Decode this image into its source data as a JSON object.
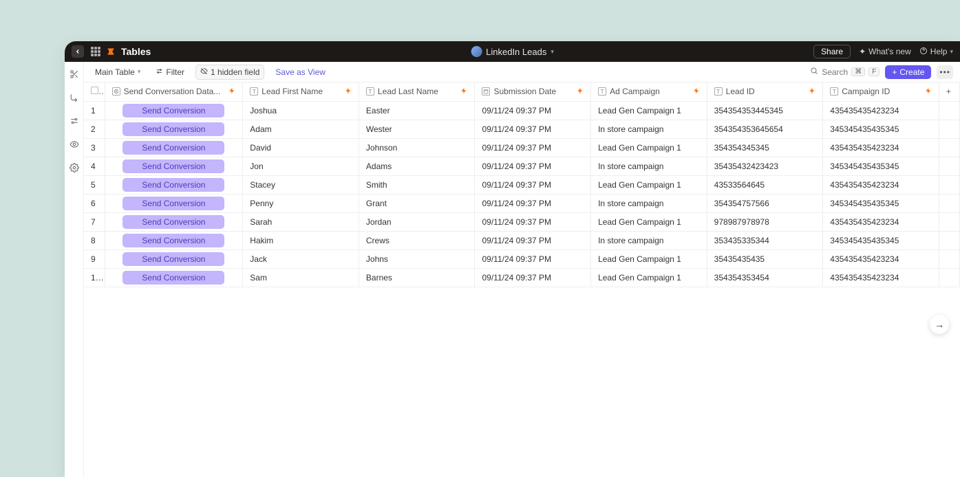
{
  "header": {
    "app_title": "Tables",
    "workspace_title": "LinkedIn Leads",
    "share": "Share",
    "whats_new": "What's new",
    "help": "Help"
  },
  "toolbar": {
    "view_name": "Main Table",
    "filter": "Filter",
    "hidden_label": "1 hidden field",
    "save_view": "Save as View",
    "search": "Search",
    "kbd1": "⌘",
    "kbd2": "F",
    "create": "Create"
  },
  "columns": [
    {
      "label": "Send Conversation Data...",
      "type": "action",
      "bolt": true
    },
    {
      "label": "Lead First Name",
      "type": "text",
      "bolt": true
    },
    {
      "label": "Lead Last Name",
      "type": "text",
      "bolt": true
    },
    {
      "label": "Submission Date",
      "type": "date",
      "bolt": true
    },
    {
      "label": "Ad Campaign",
      "type": "text",
      "bolt": true
    },
    {
      "label": "Lead ID",
      "type": "text",
      "bolt": true
    },
    {
      "label": "Campaign ID",
      "type": "text",
      "bolt": true
    }
  ],
  "action_pill_label": "Send Conversion",
  "rows": [
    {
      "first": "Joshua",
      "last": "Easter",
      "date": "09/11/24 09:37 PM",
      "campaign": "Lead Gen Campaign 1",
      "leadid": "354354353445345",
      "cid": "435435435423234"
    },
    {
      "first": "Adam",
      "last": "Wester",
      "date": "09/11/24 09:37 PM",
      "campaign": "In store campaign",
      "leadid": "354354353645654",
      "cid": "345345435435345"
    },
    {
      "first": "David",
      "last": "Johnson",
      "date": "09/11/24 09:37 PM",
      "campaign": "Lead Gen Campaign 1",
      "leadid": "354354345345",
      "cid": "435435435423234"
    },
    {
      "first": "Jon",
      "last": "Adams",
      "date": "09/11/24 09:37 PM",
      "campaign": "In store campaign",
      "leadid": "35435432423423",
      "cid": "345345435435345"
    },
    {
      "first": "Stacey",
      "last": "Smith",
      "date": "09/11/24 09:37 PM",
      "campaign": "Lead Gen Campaign 1",
      "leadid": "43533564645",
      "cid": "435435435423234"
    },
    {
      "first": "Penny",
      "last": "Grant",
      "date": "09/11/24 09:37 PM",
      "campaign": "In store campaign",
      "leadid": "354354757566",
      "cid": "345345435435345"
    },
    {
      "first": "Sarah",
      "last": "Jordan",
      "date": "09/11/24 09:37 PM",
      "campaign": "Lead Gen Campaign 1",
      "leadid": "978987978978",
      "cid": "435435435423234"
    },
    {
      "first": "Hakim",
      "last": "Crews",
      "date": "09/11/24 09:37 PM",
      "campaign": "In store campaign",
      "leadid": "353435335344",
      "cid": "345345435435345"
    },
    {
      "first": "Jack",
      "last": "Johns",
      "date": "09/11/24 09:37 PM",
      "campaign": "Lead Gen Campaign 1",
      "leadid": "35435435435",
      "cid": "435435435423234"
    },
    {
      "first": "Sam",
      "last": "Barnes",
      "date": "09/11/24 09:37 PM",
      "campaign": "Lead Gen Campaign 1",
      "leadid": "354354353454",
      "cid": "435435435423234"
    }
  ]
}
